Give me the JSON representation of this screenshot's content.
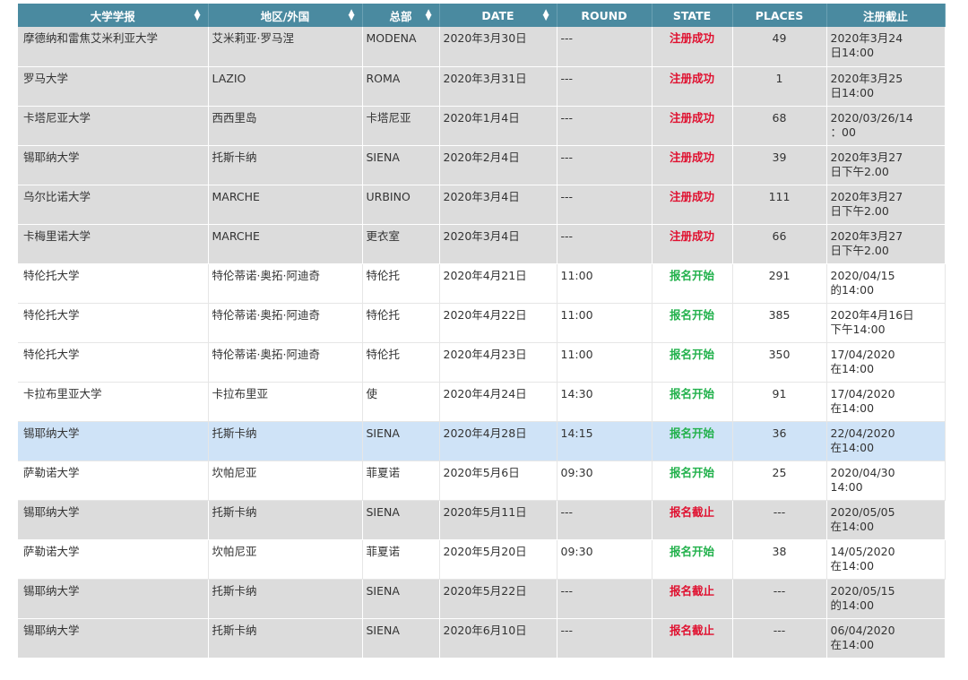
{
  "headers": [
    "大学学报",
    "地区/外国",
    "总部",
    "DATE",
    "ROUND",
    "STATE",
    "PLACES",
    "注册截止"
  ],
  "colors": {
    "header_bg": "#4a8aa0",
    "state_closed": "#e0102f",
    "state_open": "#22b14c",
    "row_gray": "#dcdcdc",
    "row_selected": "#cfe3f7"
  },
  "rows": [
    {
      "uni": "摩德纳和雷焦艾米利亚大学",
      "region": "艾米莉亚·罗马涅",
      "hq": "MODENA",
      "date": "2020年3月30日",
      "round": "---",
      "state": "注册成功",
      "places": "49",
      "deadline1": "2020年3月24",
      "deadline2": "日14:00"
    },
    {
      "uni": "罗马大学",
      "region": "LAZIO",
      "hq": "ROMA",
      "date": "2020年3月31日",
      "round": "---",
      "state": "注册成功",
      "places": "1",
      "deadline1": "2020年3月25",
      "deadline2": "日14:00"
    },
    {
      "uni": "卡塔尼亚大学",
      "region": "西西里岛",
      "hq": "卡塔尼亚",
      "date": "2020年1月4日",
      "round": "---",
      "state": "注册成功",
      "places": "68",
      "deadline1": "2020/03/26/14",
      "deadline2": "：00"
    },
    {
      "uni": "锡耶纳大学",
      "region": "托斯卡纳",
      "hq": "SIENA",
      "date": "2020年2月4日",
      "round": "---",
      "state": "注册成功",
      "places": "39",
      "deadline1": "2020年3月27",
      "deadline2": "日下午2.00"
    },
    {
      "uni": "乌尔比诺大学",
      "region": "MARCHE",
      "hq": "URBINO",
      "date": "2020年3月4日",
      "round": "---",
      "state": "注册成功",
      "places": "111",
      "deadline1": "2020年3月27",
      "deadline2": "日下午2.00"
    },
    {
      "uni": "卡梅里诺大学",
      "region": "MARCHE",
      "hq": "更衣室",
      "date": "2020年3月4日",
      "round": "---",
      "state": "注册成功",
      "places": "66",
      "deadline1": "2020年3月27",
      "deadline2": "日下午2.00"
    },
    {
      "uni": "特伦托大学",
      "region": "特伦蒂诺·奥拓·阿迪奇",
      "hq": "特伦托",
      "date": "2020年4月21日",
      "round": "11:00",
      "state": "报名开始",
      "places": "291",
      "deadline1": "2020/04/15",
      "deadline2": "的14:00"
    },
    {
      "uni": "特伦托大学",
      "region": "特伦蒂诺·奥拓·阿迪奇",
      "hq": "特伦托",
      "date": "2020年4月22日",
      "round": "11:00",
      "state": "报名开始",
      "places": "385",
      "deadline1": "2020年4月16日",
      "deadline2": "下午14:00"
    },
    {
      "uni": "特伦托大学",
      "region": "特伦蒂诺·奥拓·阿迪奇",
      "hq": "特伦托",
      "date": "2020年4月23日",
      "round": "11:00",
      "state": "报名开始",
      "places": "350",
      "deadline1": "17/04/2020",
      "deadline2": "在14:00"
    },
    {
      "uni": "卡拉布里亚大学",
      "region": "卡拉布里亚",
      "hq": "使",
      "date": "2020年4月24日",
      "round": "14:30",
      "state": "报名开始",
      "places": "91",
      "deadline1": "17/04/2020",
      "deadline2": "在14:00"
    },
    {
      "uni": "锡耶纳大学",
      "region": "托斯卡纳",
      "hq": "SIENA",
      "date": "2020年4月28日",
      "round": "14:15",
      "state": "报名开始",
      "places": "36",
      "deadline1": "22/04/2020",
      "deadline2": "在14:00"
    },
    {
      "uni": "萨勒诺大学",
      "region": "坎帕尼亚",
      "hq": "菲夏诺",
      "date": "2020年5月6日",
      "round": "09:30",
      "state": "报名开始",
      "places": "25",
      "deadline1": "2020/04/30",
      "deadline2": "14:00"
    },
    {
      "uni": "锡耶纳大学",
      "region": "托斯卡纳",
      "hq": "SIENA",
      "date": "2020年5月11日",
      "round": "---",
      "state": "报名截止",
      "places": "---",
      "deadline1": "2020/05/05",
      "deadline2": "在14:00"
    },
    {
      "uni": "萨勒诺大学",
      "region": "坎帕尼亚",
      "hq": "菲夏诺",
      "date": "2020年5月20日",
      "round": "09:30",
      "state": "报名开始",
      "places": "38",
      "deadline1": "14/05/2020",
      "deadline2": "在14:00"
    },
    {
      "uni": "锡耶纳大学",
      "region": "托斯卡纳",
      "hq": "SIENA",
      "date": "2020年5月22日",
      "round": "---",
      "state": "报名截止",
      "places": "---",
      "deadline1": "2020/05/15",
      "deadline2": "的14:00"
    },
    {
      "uni": "锡耶纳大学",
      "region": "托斯卡纳",
      "hq": "SIENA",
      "date": "2020年6月10日",
      "round": "---",
      "state": "报名截止",
      "places": "---",
      "deadline1": "06/04/2020",
      "deadline2": "在14:00"
    }
  ]
}
